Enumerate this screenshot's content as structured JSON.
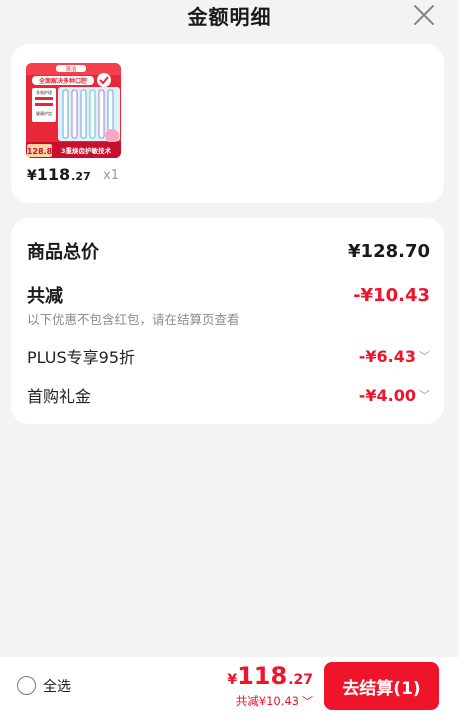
{
  "header": {
    "title": "金额明细",
    "close_icon": "close-icon"
  },
  "product": {
    "image_icon": "product-image",
    "image_text": {
      "brand": "清洁",
      "banner": "全面解决多种口腔",
      "tag1": "多效护理",
      "tag2": "健康护齿",
      "price": "128.8",
      "slogan": "3重焕齿护敏技术"
    },
    "price_symbol": "¥",
    "price_int": "118",
    "price_dec": ".27",
    "quantity": "x1"
  },
  "detail": {
    "total_label": "商品总价",
    "total_value": "¥128.70",
    "reduce_label": "共减",
    "reduce_value": "-¥10.43",
    "reduce_note": "以下优惠不包含红包，请在结算页查看",
    "discounts": [
      {
        "label": "PLUS专享95折",
        "value": "-¥6.43"
      },
      {
        "label": "首购礼金",
        "value": "-¥4.00"
      }
    ]
  },
  "footer": {
    "select_all_label": "全选",
    "total_symbol": "¥",
    "total_int": "118",
    "total_dec": ".27",
    "reduce_text": "共减¥10.43",
    "checkout_label": "去结算(1)"
  },
  "colors": {
    "accent": "#f0142b",
    "background": "#f3f3f3",
    "card": "#ffffff"
  }
}
